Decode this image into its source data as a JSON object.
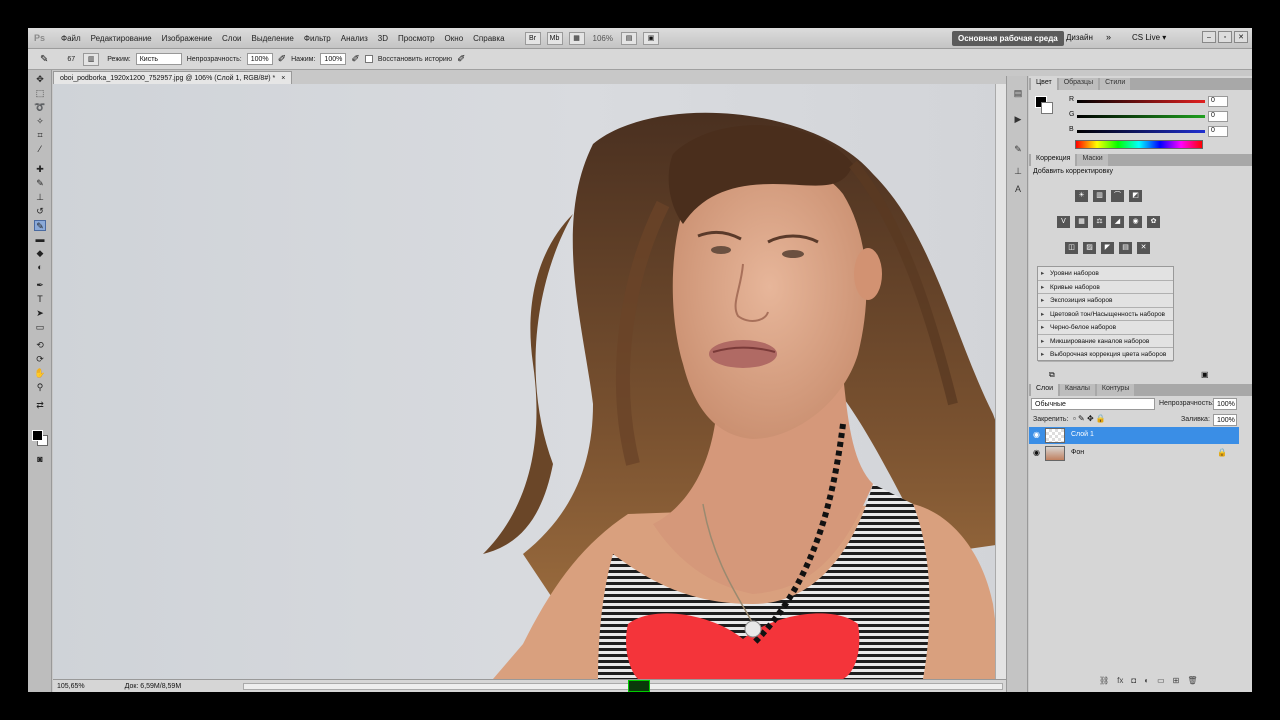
{
  "menu": {
    "logo": "Ps",
    "items": [
      "Файл",
      "Редактирование",
      "Изображение",
      "Слои",
      "Выделение",
      "Фильтр",
      "Анализ",
      "3D",
      "Просмотр",
      "Окно",
      "Справка"
    ],
    "zoom": "106%",
    "workspace": "Основная рабочая среда",
    "design": "Дизайн",
    "chevron": "»",
    "cslive": "CS Live ▾"
  },
  "options": {
    "brush_size": "67",
    "mode_label": "Режим:",
    "mode_value": "Кисть",
    "opacity_label": "Непрозрачность:",
    "opacity_value": "100%",
    "pressure_label": "Нажим:",
    "pressure_value": "100%",
    "restore_label": "Восстановить историю"
  },
  "document": {
    "tab_title": "oboi_podborka_1920x1200_752957.jpg @ 106% (Слой 1, RGB/8#) *",
    "close": "×"
  },
  "status": {
    "zoom": "105,65%",
    "doc_size": "Док: 6,59M/8,59M"
  },
  "color_panel": {
    "tabs": [
      "Цвет",
      "Образцы",
      "Стили"
    ],
    "channels": [
      {
        "label": "R",
        "value": "0",
        "color": "#e02020"
      },
      {
        "label": "G",
        "value": "0",
        "color": "#20a020"
      },
      {
        "label": "B",
        "value": "0",
        "color": "#2030d0"
      }
    ]
  },
  "adjust_panel": {
    "tabs": [
      "Коррекция",
      "Маски"
    ],
    "title": "Добавить корректировку",
    "presets": [
      "Уровни наборов",
      "Кривые наборов",
      "Экспозиция наборов",
      "Цветовой тон/Насыщенность наборов",
      "Черно-белое наборов",
      "Микширование каналов наборов",
      "Выборочная коррекция цвета наборов"
    ]
  },
  "layers_panel": {
    "tabs": [
      "Слои",
      "Каналы",
      "Контуры"
    ],
    "blend_mode": "Обычные",
    "opacity_label": "Непрозрачность:",
    "opacity_value": "100%",
    "lock_label": "Закрепить:",
    "fill_label": "Заливка:",
    "fill_value": "100%",
    "layers": [
      {
        "name": "Слой 1",
        "selected": true
      },
      {
        "name": "Фон",
        "selected": false
      }
    ]
  }
}
